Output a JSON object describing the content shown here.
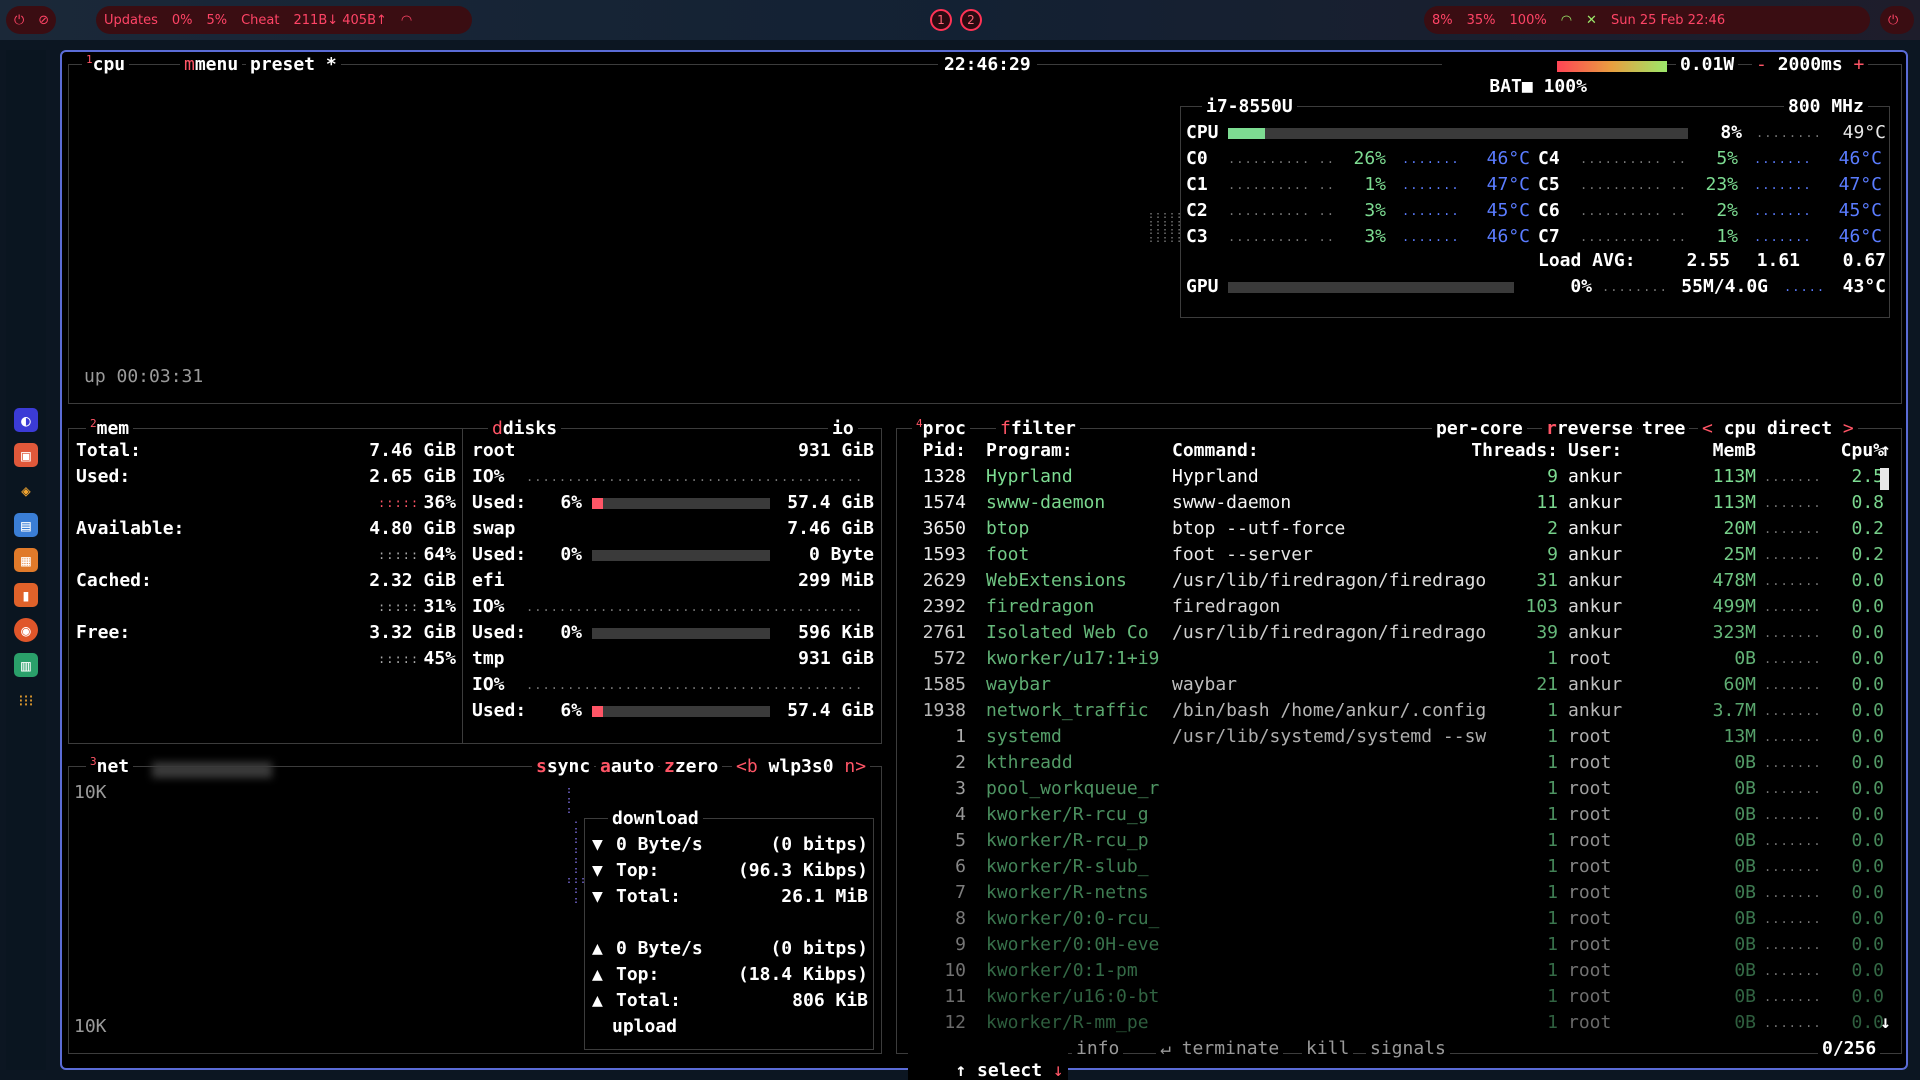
{
  "topbar": {
    "left_items": [
      "Updates",
      "0%",
      "5%",
      "Cheat",
      "211B↓ 405B↑"
    ],
    "workspaces": [
      "1",
      "2"
    ],
    "right_items": [
      "8%",
      "35%",
      "100%"
    ],
    "datetime": "Sun 25 Feb 22:46"
  },
  "cpu": {
    "tab_num": "1",
    "tabs": [
      "cpu",
      "menu",
      "preset *"
    ],
    "clock": "22:46:29",
    "battery_label": "BAT",
    "battery_pct": "100%",
    "power": "0.01W",
    "interval": "2000ms",
    "model": "i7-8550U",
    "freq": "800 MHz",
    "total_label": "CPU",
    "total_pct": "8%",
    "total_temp": "49°C",
    "total_value": 0.08,
    "cores": [
      {
        "name": "C0",
        "pct": "26%",
        "temp": "46°C"
      },
      {
        "name": "C1",
        "pct": "1%",
        "temp": "47°C"
      },
      {
        "name": "C2",
        "pct": "3%",
        "temp": "45°C"
      },
      {
        "name": "C3",
        "pct": "3%",
        "temp": "46°C"
      },
      {
        "name": "C4",
        "pct": "5%",
        "temp": "46°C"
      },
      {
        "name": "C5",
        "pct": "23%",
        "temp": "47°C"
      },
      {
        "name": "C6",
        "pct": "2%",
        "temp": "45°C"
      },
      {
        "name": "C7",
        "pct": "1%",
        "temp": "46°C"
      }
    ],
    "load_label": "Load AVG:",
    "load": [
      "2.55",
      "1.61",
      "0.67"
    ],
    "gpu_label": "GPU",
    "gpu_pct": "0%",
    "gpu_mem": "55M/4.0G",
    "gpu_temp": "43°C",
    "uptime": "up 00:03:31"
  },
  "mem": {
    "tab_num": "2",
    "title": "mem",
    "rows": [
      {
        "label": "Total:",
        "value": "7.46 GiB"
      },
      {
        "label": "Used:",
        "value": "2.65 GiB",
        "pct": "36%"
      },
      {
        "label": "Available:",
        "value": "4.80 GiB",
        "pct": "64%"
      },
      {
        "label": "Cached:",
        "value": "2.32 GiB",
        "pct": "31%"
      },
      {
        "label": "Free:",
        "value": "3.32 GiB",
        "pct": "45%"
      }
    ]
  },
  "disks": {
    "title": "disks",
    "io_label": "io",
    "items": [
      {
        "name": "root",
        "size": "931 GiB",
        "io": "IO%",
        "used_label": "Used:",
        "used_pct": "6%",
        "used": "57.4 GiB",
        "fill": 0.06
      },
      {
        "name": "swap",
        "size": "7.46 GiB",
        "io": "",
        "used_label": "Used:",
        "used_pct": "0%",
        "used": "0 Byte",
        "fill": 0.0
      },
      {
        "name": "efi",
        "size": "299 MiB",
        "io": "IO%",
        "used_label": "Used:",
        "used_pct": "0%",
        "used": "596 KiB",
        "fill": 0.0
      },
      {
        "name": "tmp",
        "size": "931 GiB",
        "io": "IO%",
        "used_label": "Used:",
        "used_pct": "6%",
        "used": "57.4 GiB",
        "fill": 0.06
      }
    ]
  },
  "net": {
    "tab_num": "3",
    "title": "net",
    "tabs": [
      "sync",
      "auto",
      "zero"
    ],
    "iface_prev": "<b",
    "iface": "wlp3s0",
    "iface_next": "n>",
    "scale_top": "10K",
    "scale_bottom": "10K",
    "download_title": "download",
    "upload_title": "upload",
    "download": [
      {
        "label": "0 Byte/s",
        "value": "(0 bitps)"
      },
      {
        "label": "Top:",
        "value": "(96.3 Kibps)"
      },
      {
        "label": "Total:",
        "value": "26.1 MiB"
      }
    ],
    "upload": [
      {
        "label": "0 Byte/s",
        "value": "(0 bitps)"
      },
      {
        "label": "Top:",
        "value": "(18.4 Kibps)"
      },
      {
        "label": "Total:",
        "value": "806 KiB"
      }
    ]
  },
  "proc": {
    "tab_num": "4",
    "title": "proc",
    "filter_label": "filter",
    "options": [
      "per-core",
      "reverse",
      "tree"
    ],
    "sort_prev": "<",
    "sort": "cpu direct",
    "sort_next": ">",
    "headers": {
      "pid": "Pid:",
      "program": "Program:",
      "command": "Command:",
      "threads": "Threads:",
      "user": "User:",
      "mem": "MemB",
      "cpu": "Cpu%"
    },
    "rows": [
      {
        "pid": "1328",
        "program": "Hyprland",
        "command": "Hyprland",
        "threads": "9",
        "user": "ankur",
        "mem": "113M",
        "cpu": "2.5"
      },
      {
        "pid": "1574",
        "program": "swww-daemon",
        "command": "swww-daemon",
        "threads": "11",
        "user": "ankur",
        "mem": "113M",
        "cpu": "0.8"
      },
      {
        "pid": "3650",
        "program": "btop",
        "command": "btop --utf-force",
        "threads": "2",
        "user": "ankur",
        "mem": "20M",
        "cpu": "0.2"
      },
      {
        "pid": "1593",
        "program": "foot",
        "command": "foot --server",
        "threads": "9",
        "user": "ankur",
        "mem": "25M",
        "cpu": "0.2"
      },
      {
        "pid": "2629",
        "program": "WebExtensions",
        "command": "/usr/lib/firedragon/firedrago",
        "threads": "31",
        "user": "ankur",
        "mem": "478M",
        "cpu": "0.0"
      },
      {
        "pid": "2392",
        "program": "firedragon",
        "command": "firedragon",
        "threads": "103",
        "user": "ankur",
        "mem": "499M",
        "cpu": "0.0"
      },
      {
        "pid": "2761",
        "program": "Isolated Web Co",
        "command": "/usr/lib/firedragon/firedrago",
        "threads": "39",
        "user": "ankur",
        "mem": "323M",
        "cpu": "0.0"
      },
      {
        "pid": "572",
        "program": "kworker/u17:1+i9",
        "command": "",
        "threads": "1",
        "user": "root",
        "mem": "0B",
        "cpu": "0.0"
      },
      {
        "pid": "1585",
        "program": "waybar",
        "command": "waybar",
        "threads": "21",
        "user": "ankur",
        "mem": "60M",
        "cpu": "0.0"
      },
      {
        "pid": "1938",
        "program": "network_traffic",
        "command": "/bin/bash /home/ankur/.config",
        "threads": "1",
        "user": "ankur",
        "mem": "3.7M",
        "cpu": "0.0"
      },
      {
        "pid": "1",
        "program": "systemd",
        "command": "/usr/lib/systemd/systemd --sw",
        "threads": "1",
        "user": "root",
        "mem": "13M",
        "cpu": "0.0"
      },
      {
        "pid": "2",
        "program": "kthreadd",
        "command": "",
        "threads": "1",
        "user": "root",
        "mem": "0B",
        "cpu": "0.0"
      },
      {
        "pid": "3",
        "program": "pool_workqueue_r",
        "command": "",
        "threads": "1",
        "user": "root",
        "mem": "0B",
        "cpu": "0.0"
      },
      {
        "pid": "4",
        "program": "kworker/R-rcu_g",
        "command": "",
        "threads": "1",
        "user": "root",
        "mem": "0B",
        "cpu": "0.0"
      },
      {
        "pid": "5",
        "program": "kworker/R-rcu_p",
        "command": "",
        "threads": "1",
        "user": "root",
        "mem": "0B",
        "cpu": "0.0"
      },
      {
        "pid": "6",
        "program": "kworker/R-slub_",
        "command": "",
        "threads": "1",
        "user": "root",
        "mem": "0B",
        "cpu": "0.0"
      },
      {
        "pid": "7",
        "program": "kworker/R-netns",
        "command": "",
        "threads": "1",
        "user": "root",
        "mem": "0B",
        "cpu": "0.0"
      },
      {
        "pid": "8",
        "program": "kworker/0:0-rcu_",
        "command": "",
        "threads": "1",
        "user": "root",
        "mem": "0B",
        "cpu": "0.0"
      },
      {
        "pid": "9",
        "program": "kworker/0:0H-eve",
        "command": "",
        "threads": "1",
        "user": "root",
        "mem": "0B",
        "cpu": "0.0"
      },
      {
        "pid": "10",
        "program": "kworker/0:1-pm",
        "command": "",
        "threads": "1",
        "user": "root",
        "mem": "0B",
        "cpu": "0.0"
      },
      {
        "pid": "11",
        "program": "kworker/u16:0-bt",
        "command": "",
        "threads": "1",
        "user": "root",
        "mem": "0B",
        "cpu": "0.0"
      },
      {
        "pid": "12",
        "program": "kworker/R-mm_pe",
        "command": "",
        "threads": "1",
        "user": "root",
        "mem": "0B",
        "cpu": "0.0"
      }
    ],
    "footer": {
      "select": "select",
      "info": "info",
      "terminate": "terminate",
      "kill": "kill",
      "signals": "signals",
      "count": "0/256"
    }
  },
  "colors": {
    "accent": "#ff5566",
    "border": "#5b6cd6",
    "green": "#7ddc92",
    "blue": "#5a7cff"
  }
}
